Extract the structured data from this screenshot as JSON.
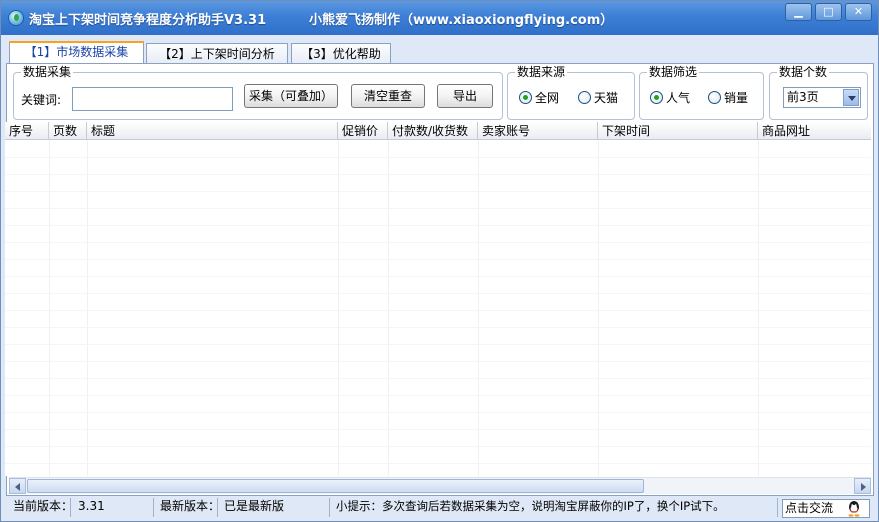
{
  "window": {
    "title": "淘宝上下架时间竞争程度分析助手V3.31",
    "credit": "小熊爱飞扬制作（www.xiaoxiongflying.com）",
    "minimize_glyph": "▁",
    "maximize_glyph": "□",
    "close_glyph": "✕"
  },
  "tabs": [
    {
      "label": "【1】市场数据采集",
      "active": true
    },
    {
      "label": "【2】上下架时间分析",
      "active": false
    },
    {
      "label": "【3】优化帮助",
      "active": false
    }
  ],
  "collect": {
    "group_title": "数据采集",
    "keyword_label": "关键词:",
    "keyword_value": "",
    "collect_button": "采集（可叠加）",
    "clear_button": "清空重查",
    "export_button": "导出"
  },
  "source": {
    "group_title": "数据来源",
    "options": [
      {
        "label": "全网",
        "checked": true
      },
      {
        "label": "天猫",
        "checked": false
      }
    ]
  },
  "filter": {
    "group_title": "数据筛选",
    "options": [
      {
        "label": "人气",
        "checked": true
      },
      {
        "label": "销量",
        "checked": false
      }
    ]
  },
  "count": {
    "group_title": "数据个数",
    "selected": "前3页"
  },
  "grid": {
    "columns": [
      "序号",
      "页数",
      "标题",
      "促销价",
      "付款数/收货数",
      "卖家账号",
      "下架时间",
      "商品网址"
    ],
    "rows": []
  },
  "status": {
    "current_version_label": "当前版本：",
    "current_version": "3.31",
    "latest_version_label": "最新版本：",
    "latest_version": "已是最新版",
    "tip": "小提示：多次查询后若数据采集为空，说明淘宝屏蔽你的IP了，换个IP试下。",
    "chat_button": "点击交流"
  },
  "colors": {
    "titlebar": "#3d7fd6",
    "active_tab_accent": "#f7a31e",
    "radio_checked": "#21a121"
  }
}
